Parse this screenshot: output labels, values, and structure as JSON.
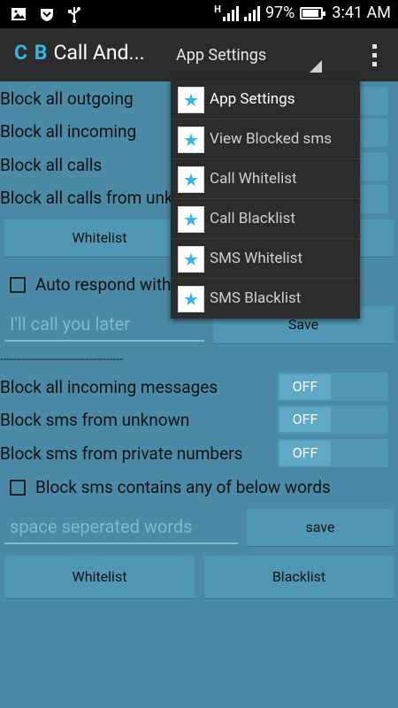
{
  "status_bar": {
    "icons": [
      "image-icon",
      "shield-icon",
      "usb-icon",
      "h-signal-icon",
      "signal-icon",
      "battery-icon"
    ],
    "network_type": "H",
    "battery_percent": "97%",
    "time": "3:41 AM"
  },
  "action_bar": {
    "logo": "C B",
    "title": "Call And...",
    "spinner_value": "App Settings",
    "overflow_icon": "overflow-menu-icon"
  },
  "calls": {
    "block_outgoing": "Block all outgoing",
    "block_incoming": "Block all incoming",
    "block_all_calls": "Block all calls",
    "block_unknown_calls": "Block all calls from unknown",
    "whitelist_button": "Whitelist",
    "auto_respond_label": "Auto respond with",
    "auto_respond_placeholder": "I'll call you later",
    "save_button": "Save"
  },
  "divider": "------------------------------------",
  "sms": {
    "block_incoming_messages": "Block all incoming messages",
    "block_unknown": "Block sms from unknown",
    "block_private": "Block sms from private numbers",
    "toggle_off": "OFF",
    "block_words_label": "Block sms contains any of below words",
    "words_placeholder": "space seperated words",
    "save_button": "save",
    "whitelist_button": "Whitelist",
    "blacklist_button": "Blacklist"
  },
  "menu": {
    "items": [
      {
        "label": "App Settings",
        "icon": "star-icon",
        "selected": true
      },
      {
        "label": "View Blocked sms",
        "icon": "star-icon"
      },
      {
        "label": "Call Whitelist",
        "icon": "star-icon"
      },
      {
        "label": "Call Blacklist",
        "icon": "star-icon"
      },
      {
        "label": "SMS Whitelist",
        "icon": "star-icon"
      },
      {
        "label": "SMS Blacklist",
        "icon": "star-icon"
      }
    ]
  },
  "colors": {
    "background": "#4a8aa6",
    "action_bar": "#2c2c2c",
    "accent": "#33b5e5"
  }
}
